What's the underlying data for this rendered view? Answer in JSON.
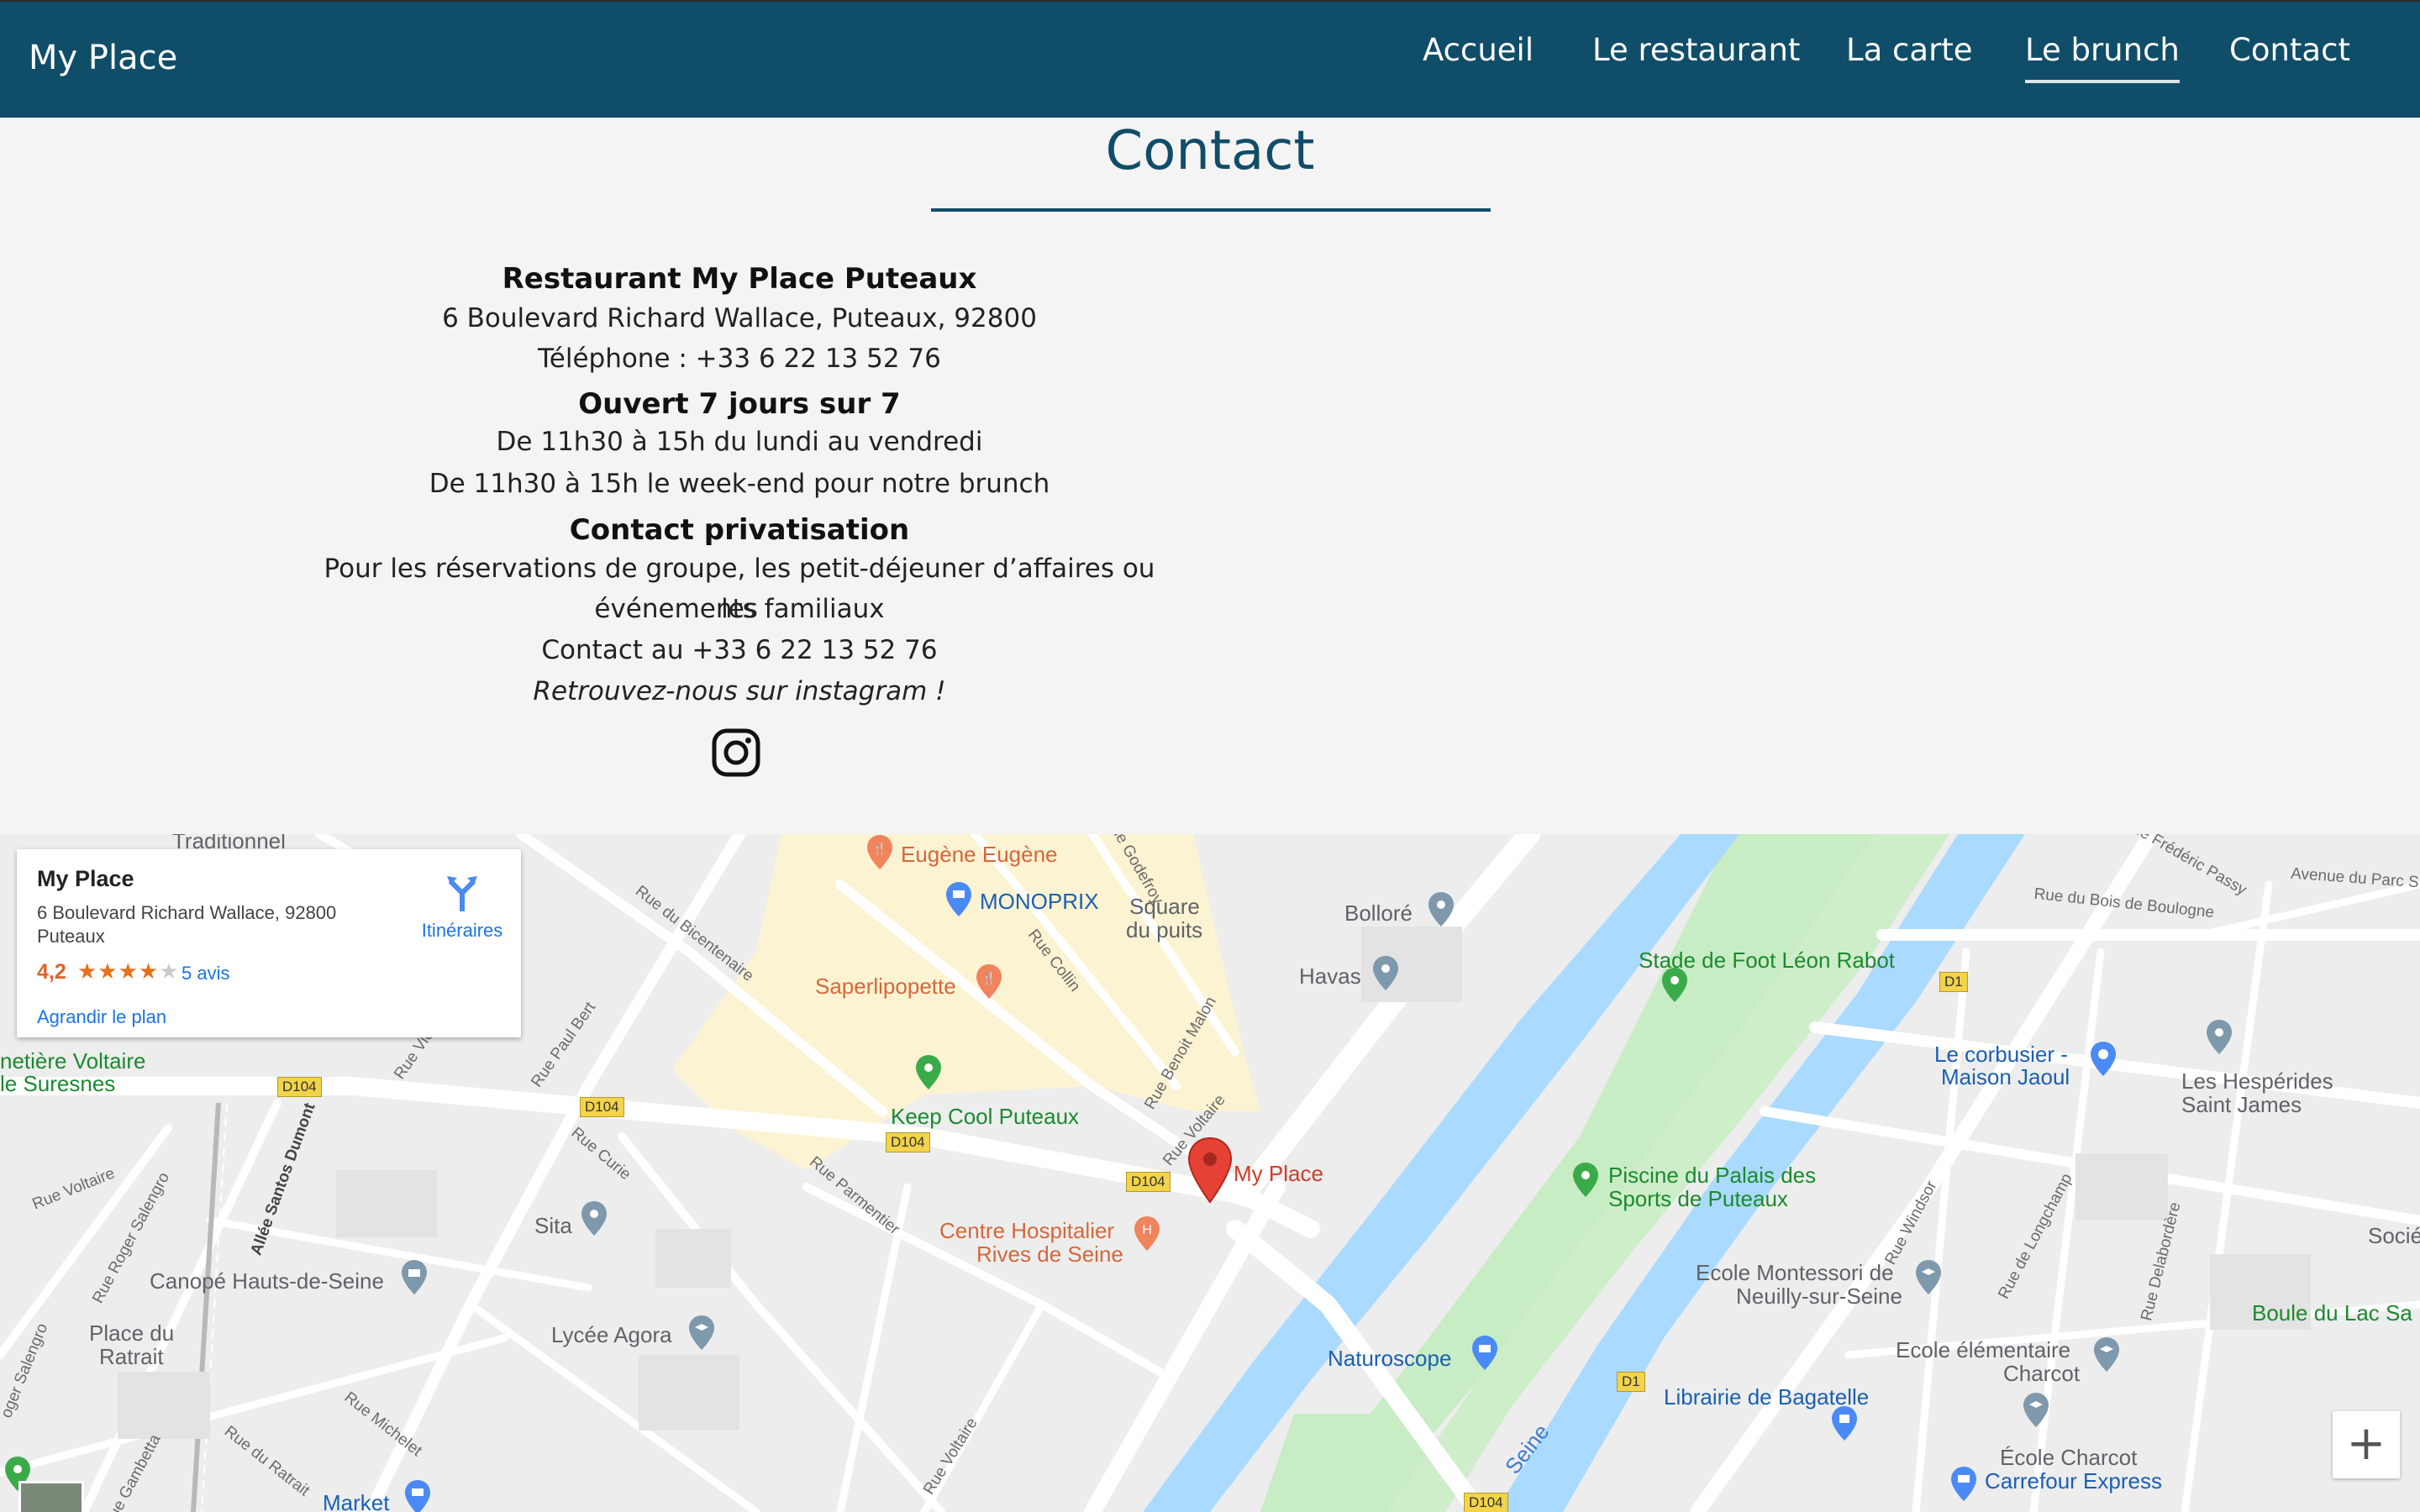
{
  "brand": "My Place",
  "nav": [
    {
      "label": "Accueil",
      "active": false
    },
    {
      "label": "Le restaurant",
      "active": false
    },
    {
      "label": "La carte",
      "active": false
    },
    {
      "label": "Le brunch",
      "active": true
    },
    {
      "label": "Contact",
      "active": false
    }
  ],
  "contact": {
    "title": "Contact",
    "restaurant_heading": "Restaurant My Place Puteaux",
    "address": "6 Boulevard Richard Wallace, Puteaux, 92800",
    "phone": "Téléphone : +33 6 22 13 52 76",
    "hours_heading": "Ouvert 7 jours sur 7",
    "hours_weekdays": "De 11h30 à 15h du lundi au vendredi",
    "hours_weekend": "De 11h30 à 15h le week-end pour notre brunch",
    "private_heading": "Contact privatisation",
    "private_text_1": "Pour les réservations de groupe, les petit-déjeuner d’affaires ou les",
    "private_text_2": "événements familiaux",
    "private_contact": "Contact au +33 6 22 13 52 76",
    "instagram_text": "Retrouvez-nous sur instagram !",
    "instagram_icon": "instagram-icon"
  },
  "map": {
    "card": {
      "name": "My Place",
      "address": "6 Boulevard Richard Wallace, 92800 Puteaux",
      "rating": "4,2",
      "stars": 4.2,
      "reviews": "5 avis",
      "directions": "Itinéraires",
      "enlarge": "Agrandir le plan"
    },
    "zoom_in": "+",
    "labels": {
      "traditionnel": "Traditionnel",
      "eugene": "Eugène Eugène",
      "monoprix": "MONOPRIX",
      "square1": "Square",
      "square2": "du puits",
      "bollore": "Bolloré",
      "havas": "Havas",
      "saperli": "Saperlipopette",
      "keepcool": "Keep Cool Puteaux",
      "myplace": "My Place",
      "hospital1": "Centre Hospitalier",
      "hospital2": "Rives de Seine",
      "sita": "Sita",
      "canope": "Canopé Hauts-de-Seine",
      "lycee": "Lycée Agora",
      "placedu1": "Place du",
      "placedu2": "Ratrait",
      "cimetiere1": "netière Voltaire",
      "cimetiere2": "le Suresnes",
      "stade": "Stade de Foot Léon Rabot",
      "piscine1": "Piscine du Palais des",
      "piscine2": "Sports de Puteaux",
      "naturoscope": "Naturoscope",
      "corbusier1": "Le corbusier -",
      "corbusier2": "Maison Jaoul",
      "hesperides1": "Les Hespérides",
      "hesperides2": "Saint James",
      "montessori1": "Ecole Montessori de",
      "montessori2": "Neuilly-sur-Seine",
      "elementaire1": "Ecole élémentaire",
      "elementaire2": "Charcot",
      "librairie": "Librairie de Bagatelle",
      "charcot1": "École Charcot",
      "charcot2": "Carrefour Express",
      "boule": "Boule du Lac Sa",
      "societe": "Socié",
      "market": "Market",
      "seine": "Seine"
    },
    "streets": {
      "bicentenaire": "Rue du Bicentenaire",
      "paulbert": "Rue Paul Bert",
      "curie": "Rue Curie",
      "parmentier": "Rue Parmentier",
      "voltaire1": "Rue Voltaire",
      "voltaire2": "Rue Voltaire",
      "voltaire3": "Rue Voltaire",
      "benoit": "Rue Benoit Malon",
      "cosson": "Rue Collin",
      "godefroy": "Rue Godefroy",
      "salengro": "Rue Roger Salengro",
      "santos": "Allée Santos Dumont",
      "michelet": "Rue Michelet",
      "ratrait": "Rue du Ratrait",
      "gambetta": "Rue Gambetta",
      "vic": "Rue Vic",
      "boisboulogne": "Rue du Bois de Boulogne",
      "parcst": "Avenue du Parc S",
      "passy": "Rue Frédéric Passy",
      "windsor": "Rue Windsor",
      "longchamp": "Rue de Longchamp",
      "delabordere": "Rue Delabordère",
      "roger": "oger Salengro"
    },
    "badges": {
      "d104a": "D104",
      "d104b": "D104",
      "d104c": "D104",
      "d104d": "D104",
      "d104e": "D104",
      "d1a": "D1",
      "d1b": "D1"
    }
  }
}
